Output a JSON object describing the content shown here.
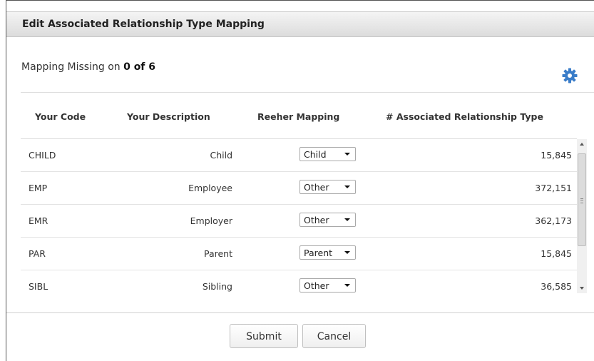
{
  "dialog": {
    "title": "Edit Associated Relationship Type Mapping"
  },
  "summary": {
    "prefix": "Mapping Missing on ",
    "value": "0 of 6"
  },
  "table": {
    "headers": [
      "Your Code",
      "Your Description",
      "Reeher Mapping",
      "# Associated Relationship Type"
    ],
    "rows": [
      {
        "code": "CHILD",
        "description": "Child",
        "mapping": "Child",
        "count": "15,845"
      },
      {
        "code": "EMP",
        "description": "Employee",
        "mapping": "Other",
        "count": "372,151"
      },
      {
        "code": "EMR",
        "description": "Employer",
        "mapping": "Other",
        "count": "362,173"
      },
      {
        "code": "PAR",
        "description": "Parent",
        "mapping": "Parent",
        "count": "15,845"
      },
      {
        "code": "SIBL",
        "description": "Sibling",
        "mapping": "Other",
        "count": "36,585"
      }
    ]
  },
  "buttons": {
    "submit": "Submit",
    "cancel": "Cancel"
  },
  "icons": {
    "settings": "gear-icon"
  },
  "colors": {
    "accent": "#3a7dc9"
  }
}
